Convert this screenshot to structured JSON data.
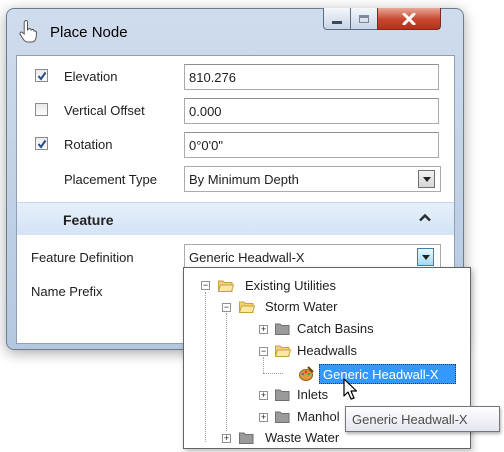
{
  "window": {
    "title": "Place Node"
  },
  "fields": {
    "elevation": {
      "label": "Elevation",
      "checked": true,
      "value": "810.276"
    },
    "vertical_offset": {
      "label": "Vertical Offset",
      "checked": false,
      "value": "0.000"
    },
    "rotation": {
      "label": "Rotation",
      "checked": true,
      "value": "0°0'0\""
    },
    "placement_type": {
      "label": "Placement Type",
      "value": "By Minimum Depth"
    }
  },
  "feature": {
    "section_label": "Feature",
    "definition_label": "Feature Definition",
    "definition_value": "Generic Headwall-X",
    "name_prefix_label": "Name Prefix"
  },
  "tree": {
    "existing_utilities": "Existing Utilities",
    "storm_water": "Storm Water",
    "catch_basins": "Catch Basins",
    "headwalls": "Headwalls",
    "generic_headwall": "Generic Headwall-X",
    "inlets": "Inlets",
    "manholes_partial": "Manhol",
    "waste_water": "Waste Water"
  },
  "tooltip": {
    "text": "Generic Headwall-X"
  },
  "colors": {
    "selection": "#3399ff",
    "section_bar": "#d9e7f6",
    "folder_yellow": "#f5d36b",
    "folder_gray": "#9a9a9a"
  },
  "icons": {
    "title": "hand-pointer-icon",
    "minimize": "minimize-icon",
    "maximize": "maximize-icon",
    "close": "close-icon",
    "checkbox": "checkmark-icon",
    "combo": "chevron-down-icon",
    "collapse": "chevron-up-icon",
    "feature": "paint-palette-icon",
    "cursor": "mouse-cursor-icon"
  }
}
